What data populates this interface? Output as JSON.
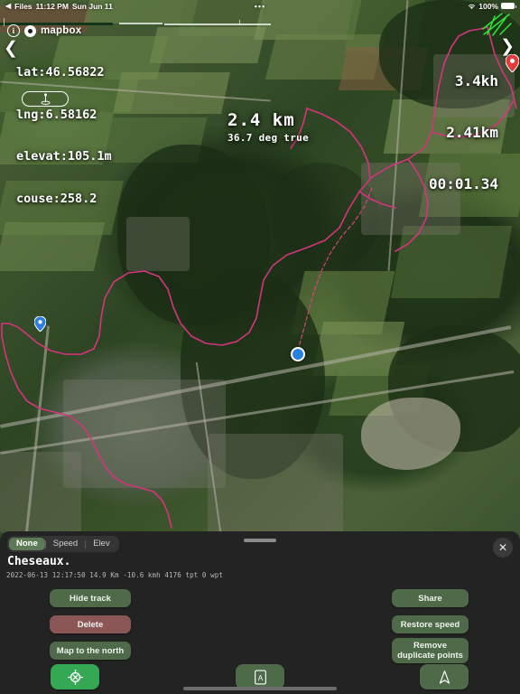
{
  "status_bar": {
    "back_label": "Files",
    "time": "11:12 PM",
    "date": "Sun Jun 11",
    "battery_percent": "100%",
    "menu_dots": "•••"
  },
  "map": {
    "attribution": "mapbox",
    "info_icon": "i",
    "left_panel": {
      "lat": "lat:46.56822",
      "lng": "lng:6.58162",
      "elevation": "elevat:105.1m",
      "course": "couse:258.2"
    },
    "right_panel": {
      "speed": "3.4kh",
      "distance": "2.41km",
      "duration": "00:01.34"
    },
    "center_label": {
      "distance": "2.4 km",
      "bearing": "36.7 deg true"
    }
  },
  "panel": {
    "segments": [
      {
        "label": "None",
        "active": true
      },
      {
        "label": "Speed",
        "active": false
      },
      {
        "label": "Elev",
        "active": false
      }
    ],
    "title": "Cheseaux.",
    "meta": "2022-06-13 12:17:50 14.9 Km -10.6 kmh 4176 tpt 0 wpt",
    "buttons_left": [
      {
        "label": "Hide track",
        "style": "green"
      },
      {
        "label": "Delete",
        "style": "danger"
      },
      {
        "label": "Map to the north",
        "style": "green"
      }
    ],
    "buttons_right": [
      {
        "label": "Share",
        "style": "green"
      },
      {
        "label": "Restore speed",
        "style": "green"
      },
      {
        "label": "Remove duplicate points",
        "style": "green"
      }
    ],
    "close_label": "✕"
  },
  "toolbar": {
    "items": [
      {
        "icon": "crosshair-target-icon",
        "style": "primary"
      },
      {
        "icon": "orientation-lock-icon",
        "style": "green"
      },
      {
        "icon": "navigation-arrow-icon",
        "style": "green"
      }
    ]
  },
  "colors": {
    "accent_green": "#34a853",
    "button_green": "#4e6a49",
    "danger_red": "#8a5656",
    "panel_bg": "#232323",
    "track_pink": "#d6337f"
  }
}
